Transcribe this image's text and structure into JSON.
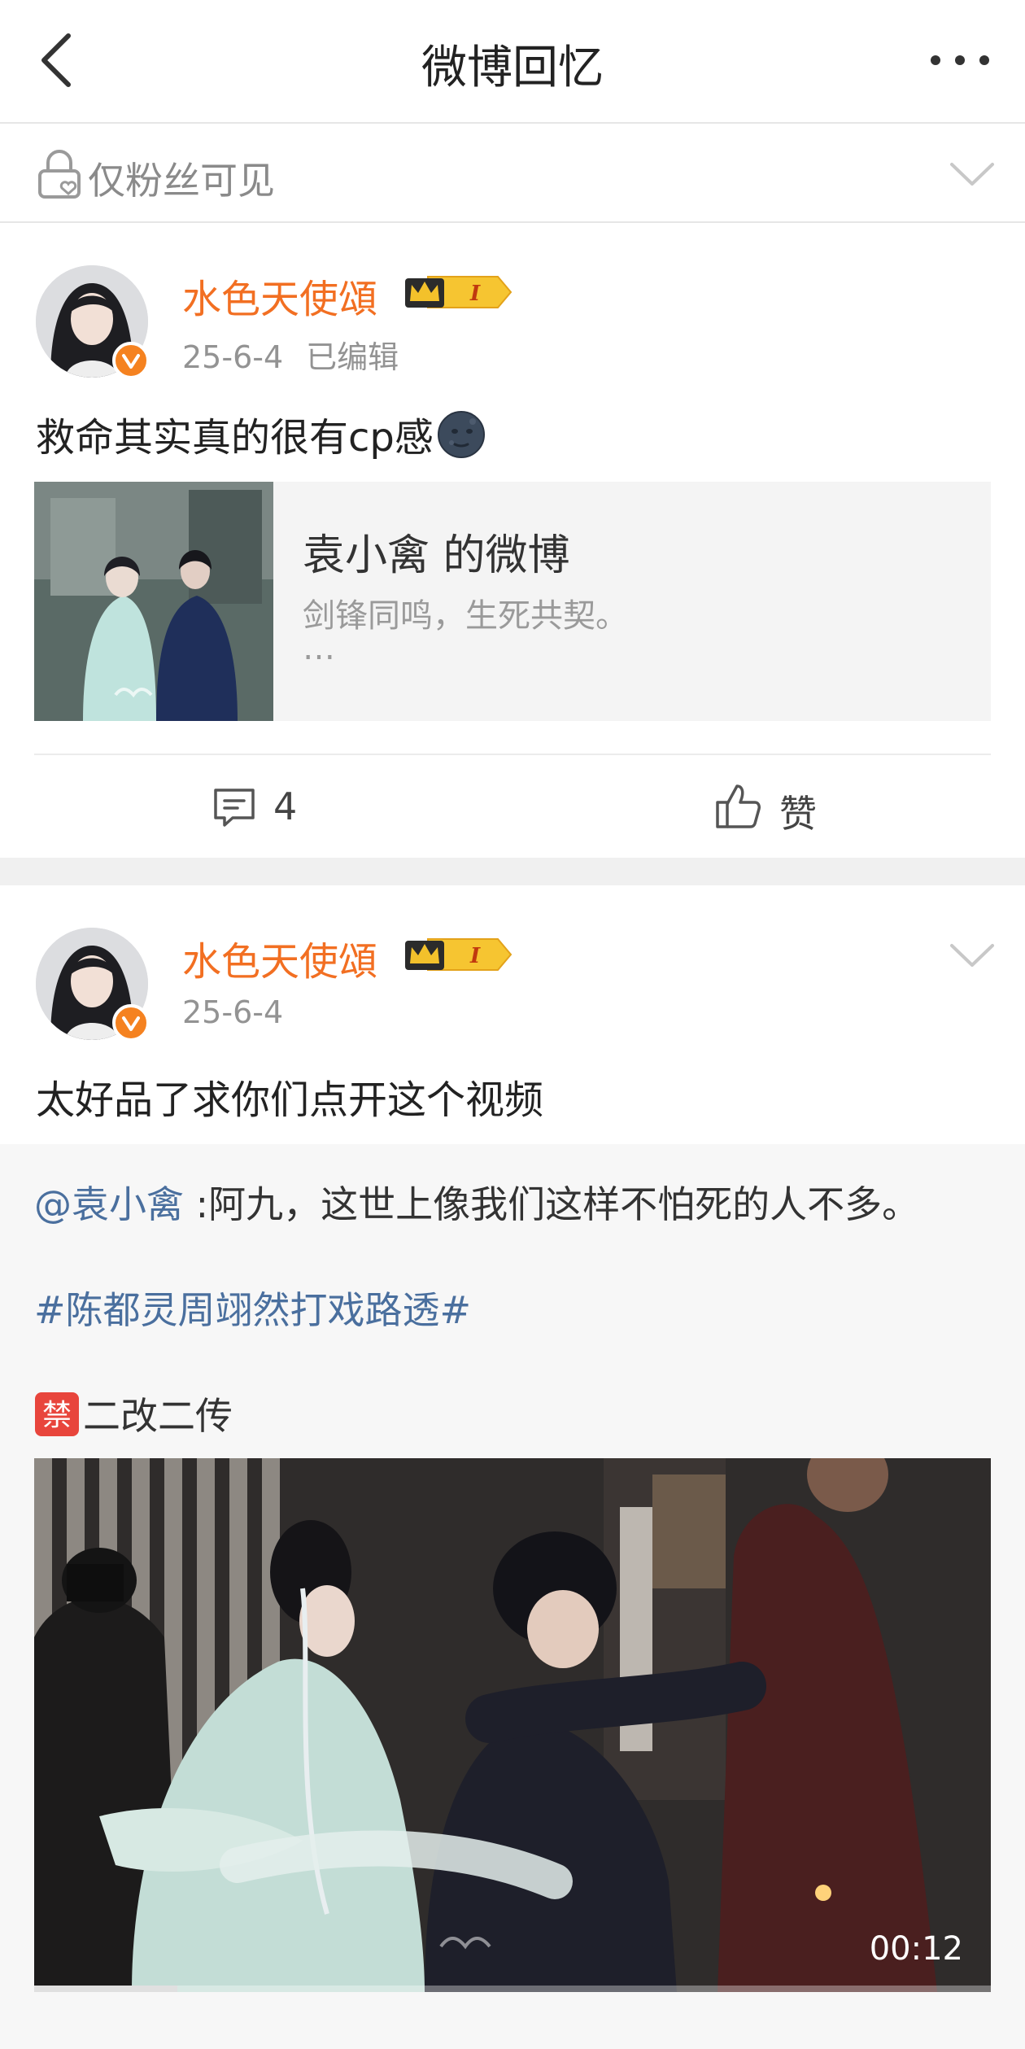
{
  "header": {
    "title": "微博回忆",
    "back_icon": "chevron-left-icon",
    "more_icon": "more-dots-icon"
  },
  "visibility": {
    "label": "仅粉丝可见",
    "icon": "lock-heart-icon"
  },
  "posts": [
    {
      "author": "水色天使頌",
      "vip_level": "I",
      "date": "25-6-4",
      "edited_label": "已编辑",
      "text": "救命其实真的很有cp感",
      "repost": {
        "title": "袁小禽 的微博",
        "excerpt": "剑锋同鸣，生死共契。",
        "ellipsis": "…"
      },
      "comments": "4",
      "like_label": "赞"
    },
    {
      "author": "水色天使頌",
      "vip_level": "I",
      "date": "25-6-4",
      "text": "太好品了求你们点开这个视频",
      "quote": {
        "mention": "@袁小禽",
        "line": " :阿九，这世上像我们这样不怕死的人不多。",
        "hashtag": "#陈都灵周翊然打戏路透#",
        "ban_icon_text": "禁",
        "ban_text": "二改二传"
      },
      "video": {
        "duration": "00:12",
        "progress": 0.15
      }
    }
  ],
  "colors": {
    "username": "#f26f22",
    "link": "#4a6f9e",
    "verified": "#f58220",
    "divider": "#f0f0f0"
  }
}
